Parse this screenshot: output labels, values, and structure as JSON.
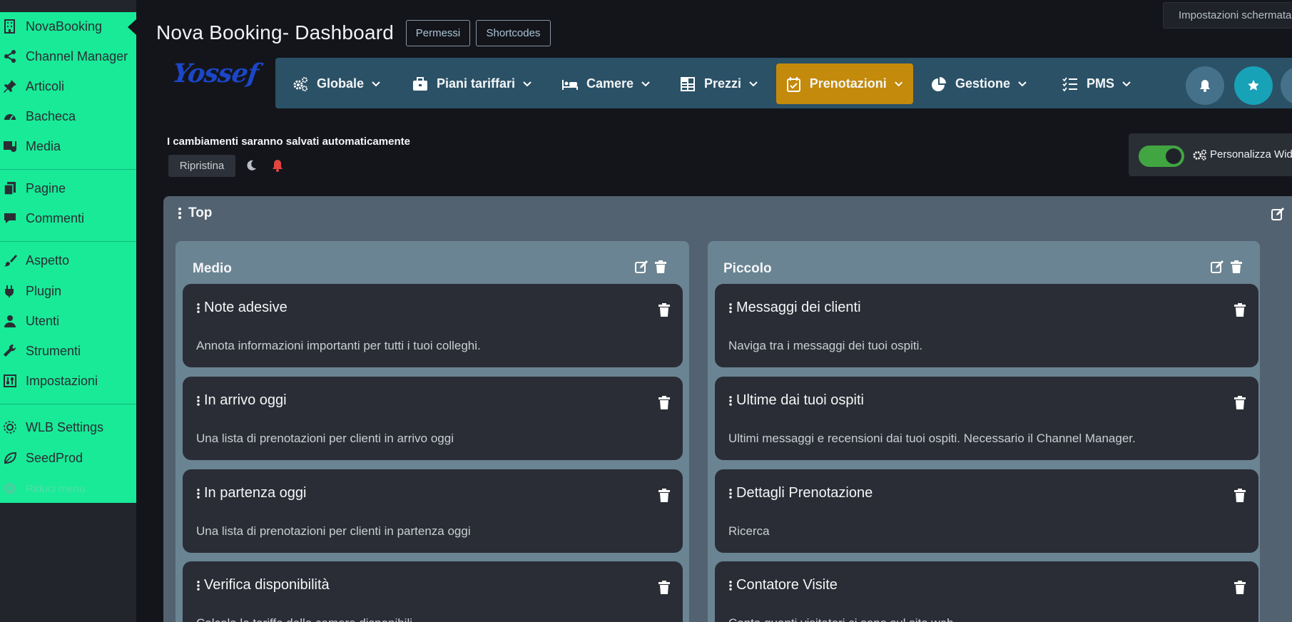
{
  "sidebar": {
    "items": [
      {
        "label": "NovaBooking",
        "icon": "building-icon"
      },
      {
        "label": "Channel Manager",
        "icon": "share-icon"
      },
      {
        "label": "Articoli",
        "icon": "pin-icon"
      },
      {
        "label": "Bacheca",
        "icon": "dashboard-icon"
      },
      {
        "label": "Media",
        "icon": "media-icon"
      },
      {
        "label": "Pagine",
        "icon": "pages-icon"
      },
      {
        "label": "Commenti",
        "icon": "comment-icon"
      },
      {
        "label": "Aspetto",
        "icon": "brush-icon"
      },
      {
        "label": "Plugin",
        "icon": "plugin-icon"
      },
      {
        "label": "Utenti",
        "icon": "user-icon"
      },
      {
        "label": "Strumenti",
        "icon": "wrench-icon"
      },
      {
        "label": "Impostazioni",
        "icon": "settings-icon"
      },
      {
        "label": "WLB Settings",
        "icon": "gear-network-icon"
      },
      {
        "label": "SeedProd",
        "icon": "leaf-icon"
      },
      {
        "label": "Riduci menu",
        "icon": "collapse-icon"
      }
    ]
  },
  "header": {
    "title": "Nova Booking- Dashboard",
    "permessi": "Permessi",
    "shortcodes": "Shortcodes",
    "screen_settings": "Impostazioni schermata",
    "logo": "Yossef"
  },
  "nav": {
    "items": [
      {
        "label": "Globale",
        "icon": "gears-icon"
      },
      {
        "label": "Piani tariffari",
        "icon": "briefcase-icon"
      },
      {
        "label": "Camere",
        "icon": "bed-icon"
      },
      {
        "label": "Prezzi",
        "icon": "table-icon"
      },
      {
        "label": "Prenotazioni",
        "icon": "calendar-check-icon",
        "active": true
      },
      {
        "label": "Gestione",
        "icon": "pie-chart-icon"
      },
      {
        "label": "PMS",
        "icon": "list-check-icon"
      }
    ]
  },
  "toolbar": {
    "autosave": "I cambiamenti saranno salvati automaticamente",
    "restore": "Ripristina",
    "customize": "Personalizza Widget",
    "toggle_on": true
  },
  "panel": {
    "title": "Top",
    "columns": [
      {
        "title": "Medio",
        "cards": [
          {
            "title": "Note adesive",
            "desc": "Annota informazioni importanti per tutti i tuoi colleghi."
          },
          {
            "title": "In arrivo oggi",
            "desc": "Una lista di prenotazioni per clienti in arrivo oggi"
          },
          {
            "title": "In partenza oggi",
            "desc": "Una lista di prenotazioni per clienti in partenza oggi"
          },
          {
            "title": "Verifica disponibilità",
            "desc": "Calcola le tariffe della camere disponibili"
          }
        ]
      },
      {
        "title": "Piccolo",
        "cards": [
          {
            "title": "Messaggi dei clienti",
            "desc": "Naviga tra i messaggi dei tuoi ospiti."
          },
          {
            "title": "Ultime dai tuoi ospiti",
            "desc": "Ultimi messaggi e recensioni dai tuoi ospiti. Necessario il Channel Manager."
          },
          {
            "title": "Dettagli Prenotazione",
            "desc": "Ricerca"
          },
          {
            "title": "Contatore Visite",
            "desc": "Conta quanti visitatori ci sono sul sito web"
          }
        ]
      }
    ]
  },
  "colors": {
    "sidebar_menu": "#18ea98",
    "nav_bg": "#2b5166",
    "nav_active": "#c48a0c",
    "toggle_on": "#41a542",
    "bell_button": "#45718a",
    "star_button": "#17a2b8"
  }
}
